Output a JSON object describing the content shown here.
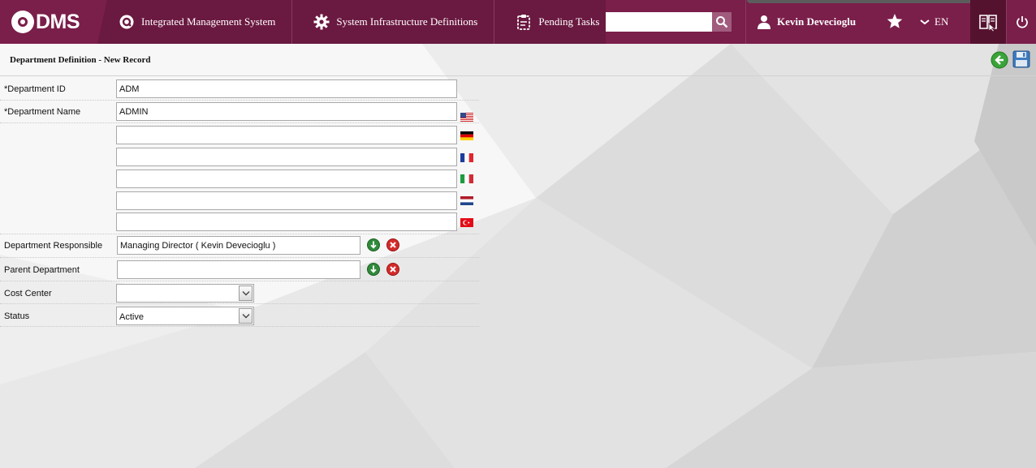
{
  "app": {
    "logo_text": "DMS",
    "nav": [
      {
        "label": "Integrated Management System",
        "icon": "q-logo-icon"
      },
      {
        "label": "System Infrastructure Definitions",
        "icon": "gear-icon"
      },
      {
        "label": "Pending Tasks",
        "icon": "clipboard-icon"
      }
    ],
    "search": {
      "value": "",
      "placeholder": ""
    },
    "user_name": "Kevin Devecioglu",
    "language": "EN",
    "colors": {
      "brand": "#7a1e4a",
      "brand_dark": "#6a1940",
      "accent_dark": "#55122f"
    }
  },
  "page": {
    "title": "Department Definition - New Record",
    "labels": {
      "department_id": "*Department ID",
      "department_name": "*Department Name",
      "department_responsible": "Department Responsible",
      "parent_department": "Parent Department",
      "cost_center": "Cost Center",
      "status": "Status"
    },
    "values": {
      "department_id": "ADM",
      "department_name_en": "ADMIN",
      "department_name_de": "",
      "department_name_fr": "",
      "department_name_it": "",
      "department_name_nl": "",
      "department_name_tr": "",
      "department_responsible": "Managing Director ( Kevin Devecioglu )",
      "parent_department": "",
      "cost_center": "",
      "status": "Active"
    },
    "language_flags": [
      "us-flag-icon",
      "germany-flag-icon",
      "france-flag-icon",
      "italy-flag-icon",
      "netherlands-flag-icon",
      "turkey-flag-icon"
    ]
  }
}
